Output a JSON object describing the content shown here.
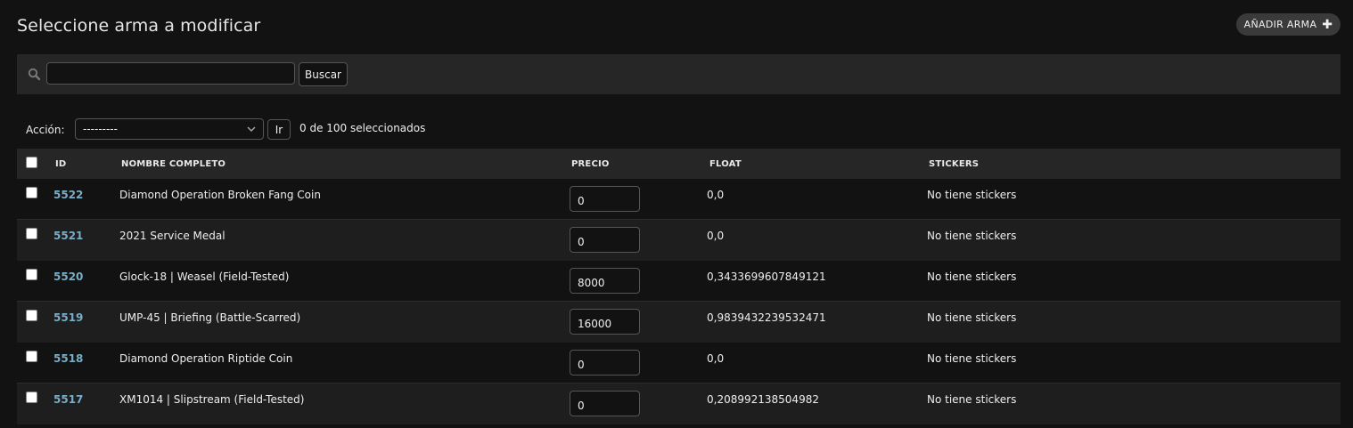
{
  "header": {
    "title": "Seleccione arma a modificar",
    "add_button_label": "AÑADIR ARMA",
    "add_icon": "plus-icon"
  },
  "search": {
    "value": "",
    "button_label": "Buscar",
    "icon": "search-icon"
  },
  "actions": {
    "label": "Acción:",
    "selected_option": "---------",
    "go_label": "Ir",
    "selection_status": "0 de 100 seleccionados"
  },
  "table": {
    "columns": [
      "ID",
      "NOMBRE COMPLETO",
      "PRECIO",
      "FLOAT",
      "STICKERS"
    ],
    "rows": [
      {
        "id": "5522",
        "name": "Diamond Operation Broken Fang Coin",
        "price": "0",
        "float": "0,0",
        "stickers": "No tiene stickers"
      },
      {
        "id": "5521",
        "name": "2021 Service Medal",
        "price": "0",
        "float": "0,0",
        "stickers": "No tiene stickers"
      },
      {
        "id": "5520",
        "name": "Glock-18 | Weasel (Field-Tested)",
        "price": "8000",
        "float": "0,3433699607849121",
        "stickers": "No tiene stickers"
      },
      {
        "id": "5519",
        "name": "UMP-45 | Briefing (Battle-Scarred)",
        "price": "16000",
        "float": "0,9839432239532471",
        "stickers": "No tiene stickers"
      },
      {
        "id": "5518",
        "name": "Diamond Operation Riptide Coin",
        "price": "0",
        "float": "0,0",
        "stickers": "No tiene stickers"
      },
      {
        "id": "5517",
        "name": "XM1014 | Slipstream (Field-Tested)",
        "price": "0",
        "float": "0,208992138504982",
        "stickers": "No tiene stickers"
      }
    ]
  },
  "colors": {
    "background": "#121212",
    "panel": "#262626",
    "link": "#79aec8"
  }
}
